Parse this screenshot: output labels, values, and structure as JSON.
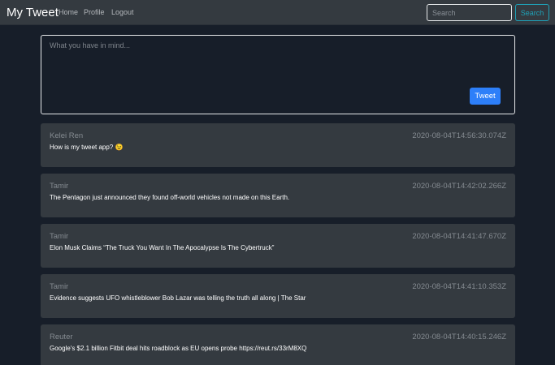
{
  "navbar": {
    "brand": "My Tweet",
    "links": [
      {
        "label": "Home"
      },
      {
        "label": "Profile"
      },
      {
        "label": "Logout"
      }
    ],
    "search": {
      "placeholder": "Search",
      "value": "",
      "button_label": "Search"
    }
  },
  "compose": {
    "placeholder": "What you have in mind...",
    "value": "",
    "button_label": "Tweet"
  },
  "tweets": [
    {
      "author": "Kelei Ren",
      "date": "2020-08-04T14:56:30.074Z",
      "text": "How is my tweet app? 😉"
    },
    {
      "author": "Tamir",
      "date": "2020-08-04T14:42:02.266Z",
      "text": "The Pentagon just announced they found off-world vehicles not made on this Earth."
    },
    {
      "author": "Tamir",
      "date": "2020-08-04T14:41:47.670Z",
      "text": "Elon Musk Claims “The Truck You Want In The Apocalypse Is The Cybertruck”"
    },
    {
      "author": "Tamir",
      "date": "2020-08-04T14:41:10.353Z",
      "text": "Evidence suggests UFO whistleblower Bob Lazar was telling the truth all along | The Star"
    },
    {
      "author": "Reuter",
      "date": "2020-08-04T14:40:15.246Z",
      "text": "Google's $2.1 billion Fitbit deal hits roadblock as EU opens probe https://reut.rs/33rM8XQ"
    }
  ],
  "colors": {
    "page_background": "#171e29",
    "navbar_background": "#343a40",
    "card_background": "#343a40",
    "primary_button": "#2d7ff9",
    "search_button_outline": "#1fa2b8",
    "muted_text": "#858b91"
  }
}
